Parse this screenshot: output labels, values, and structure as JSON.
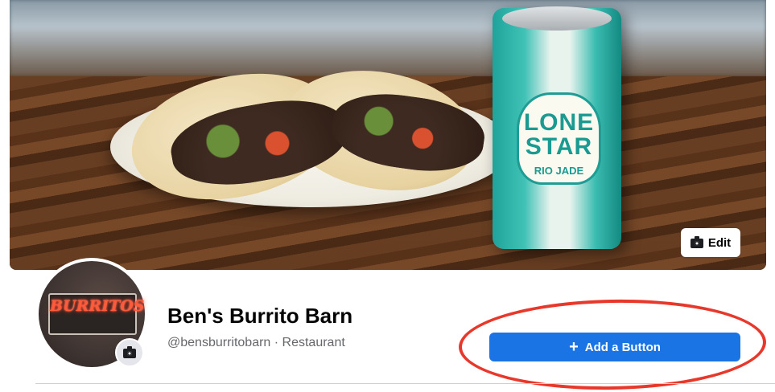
{
  "cover": {
    "can_brand": "LONE STAR",
    "can_subtitle": "RIO JADE",
    "edit_label": "Edit",
    "edit_icon": "camera-icon"
  },
  "profile": {
    "avatar_sign_text": "BURRITOS",
    "camera_icon": "camera-icon",
    "name": "Ben's Burrito Barn",
    "meta": "@bensburritobarn · Restaurant"
  },
  "actions": {
    "add_button_label": "Add a Button",
    "add_button_icon": "+",
    "primary_color": "#1b74e4"
  },
  "annotation": {
    "color": "#e8372b"
  }
}
